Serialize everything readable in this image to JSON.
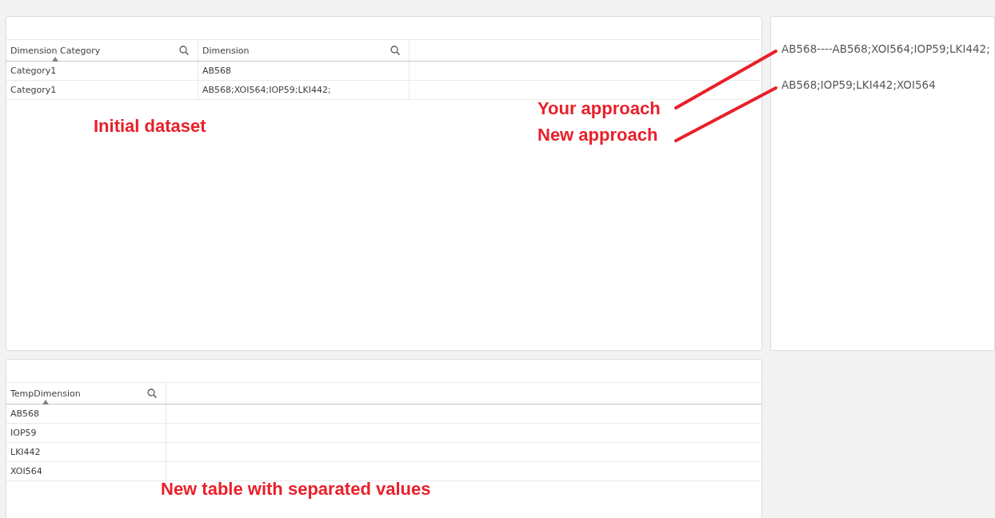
{
  "initial_table": {
    "columns": [
      {
        "label": "Dimension Category",
        "sorted": true
      },
      {
        "label": "Dimension",
        "sorted": false
      }
    ],
    "rows": [
      [
        "Category1",
        "AB568"
      ],
      [
        "Category1",
        "AB568;XOI564;IOP59;LKI442;"
      ]
    ]
  },
  "results": [
    "AB568----AB568;XOI564;IOP59;LKI442;",
    "AB568;IOP59;LKI442;XOI564"
  ],
  "temp_table": {
    "columns": [
      {
        "label": "TempDimension",
        "sorted": true
      }
    ],
    "rows": [
      [
        "AB568"
      ],
      [
        "IOP59"
      ],
      [
        "LKI442"
      ],
      [
        "XOI564"
      ]
    ]
  },
  "annotations": {
    "initial": "Initial dataset",
    "your_approach": "Your approach",
    "new_approach": "New approach",
    "new_table": "New table with separated values"
  }
}
